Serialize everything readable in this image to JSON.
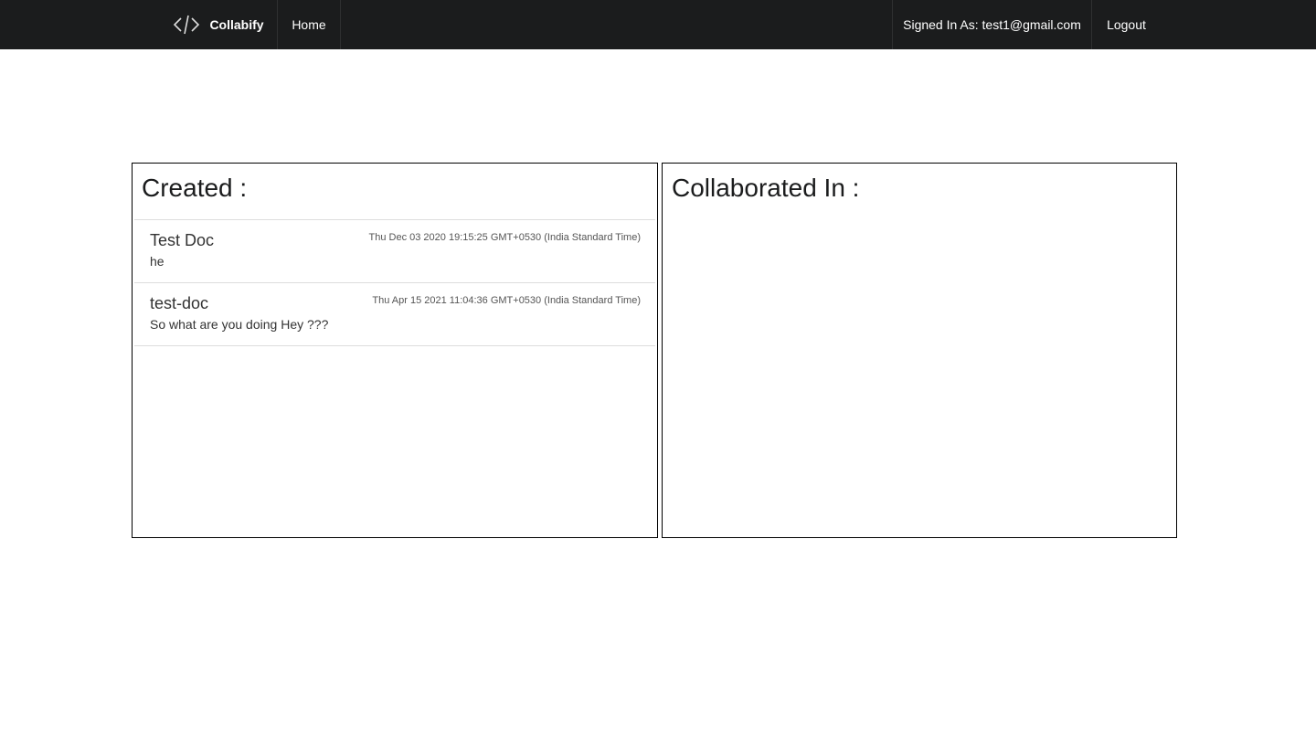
{
  "nav": {
    "brand": "Collabify",
    "brand_icon": "code-icon",
    "home": "Home",
    "signed_in": "Signed In As: test1@gmail.com",
    "logout": "Logout",
    "bg": "#1b1c1d"
  },
  "created": {
    "title": "Created :",
    "docs": [
      {
        "title": "Test Doc",
        "body": "he",
        "date": "Thu Dec 03 2020 19:15:25 GMT+0530 (India Standard Time)"
      },
      {
        "title": "test-doc",
        "body": "So what are you doing Hey ???",
        "date": "Thu Apr 15 2021 11:04:36 GMT+0530 (India Standard Time)"
      }
    ]
  },
  "collaborated": {
    "title": "Collaborated In :"
  }
}
